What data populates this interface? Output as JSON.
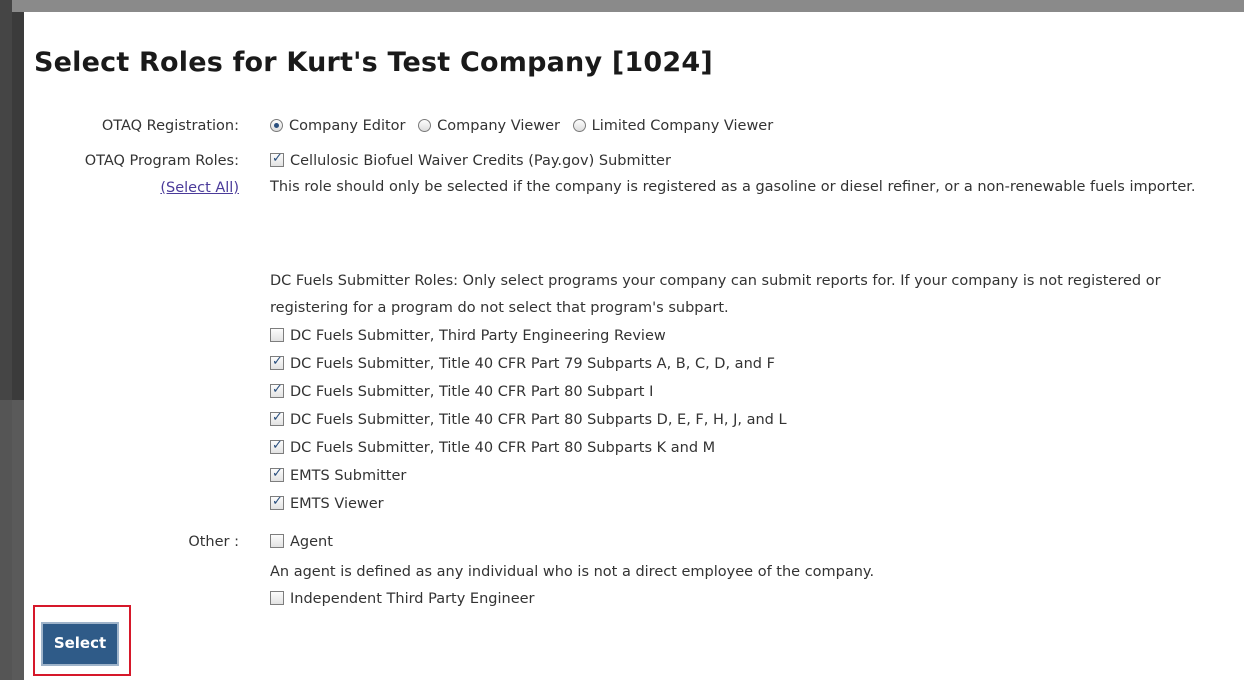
{
  "dialog": {
    "title": "Select Roles for Kurt's Test Company [1024]"
  },
  "registration": {
    "label": "OTAQ Registration:",
    "options": [
      {
        "label": "Company Editor",
        "selected": true
      },
      {
        "label": "Company Viewer",
        "selected": false
      },
      {
        "label": "Limited Company Viewer",
        "selected": false
      }
    ]
  },
  "program_roles": {
    "label": "OTAQ Program Roles:",
    "select_all": "(Select All)",
    "cellulosic": {
      "label": "Cellulosic Biofuel Waiver Credits (Pay.gov) Submitter",
      "checked": true
    },
    "cellulosic_note": "This role should only be selected if the company is registered as a gasoline or diesel refiner, or a non-renewable fuels importer.",
    "dc_note": "DC Fuels Submitter Roles: Only select programs your company can submit reports for. If your company is not registered or registering for a program do not select that program's subpart.",
    "items": [
      {
        "label": "DC Fuels Submitter, Third Party Engineering Review",
        "checked": false
      },
      {
        "label": "DC Fuels Submitter, Title 40 CFR Part 79 Subparts A, B, C, D, and F",
        "checked": true
      },
      {
        "label": "DC Fuels Submitter, Title 40 CFR Part 80 Subpart I",
        "checked": true
      },
      {
        "label": "DC Fuels Submitter, Title 40 CFR Part 80 Subparts D, E, F, H, J, and L",
        "checked": true
      },
      {
        "label": "DC Fuels Submitter, Title 40 CFR Part 80 Subparts K and M",
        "checked": true
      },
      {
        "label": "EMTS Submitter",
        "checked": true
      },
      {
        "label": "EMTS Viewer",
        "checked": true
      }
    ]
  },
  "other": {
    "label": "Other :",
    "agent": {
      "label": "Agent",
      "checked": false
    },
    "agent_note": "An agent is defined as any individual who is not a direct employee of the company.",
    "engineer": {
      "label": "Independent Third Party Engineer",
      "checked": false
    }
  },
  "actions": {
    "select_label": "Select"
  },
  "colors": {
    "button": "#2f5b88",
    "highlight": "#d6182a",
    "link": "#4b3b9a"
  }
}
